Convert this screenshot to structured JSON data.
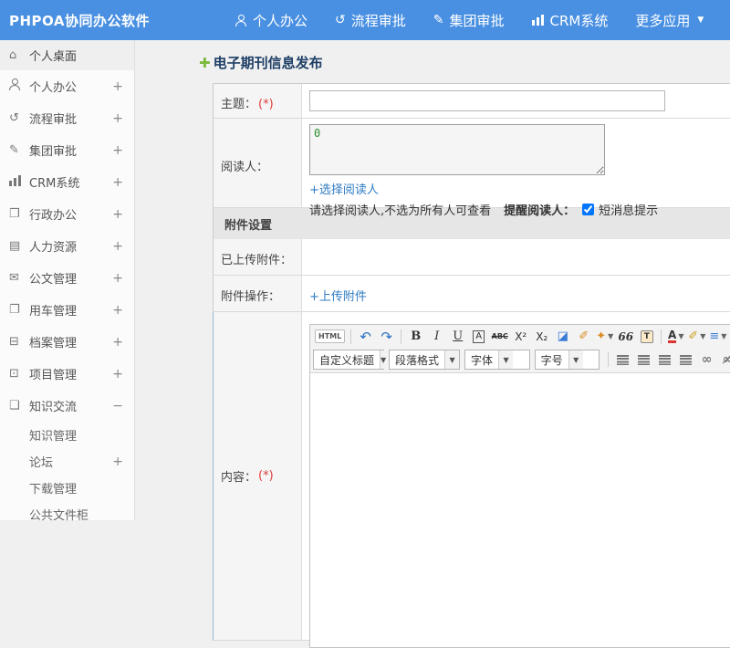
{
  "colors": {
    "header_bg": "#4a90e2",
    "accent_green": "#7cb93e",
    "link_blue": "#2f7cc4",
    "required_red": "#e03c3c",
    "title_navy": "#1f3f66"
  },
  "header": {
    "app_title": "PHPOA协同办公软件",
    "nav": [
      {
        "label": "个人办公",
        "icon": "person"
      },
      {
        "label": "流程审批",
        "icon": "workflow",
        "glyph": "↺"
      },
      {
        "label": "集团审批",
        "icon": "edit",
        "glyph": "✎"
      },
      {
        "label": "CRM系统",
        "icon": "chart-bars"
      },
      {
        "label": "更多应用",
        "icon": "more",
        "caret": "▼"
      }
    ]
  },
  "sidebar": {
    "items": [
      {
        "label": "个人桌面",
        "glyph": "⌂",
        "toggle": ""
      },
      {
        "label": "个人办公",
        "glyph": "",
        "toggle": "+"
      },
      {
        "label": "流程审批",
        "glyph": "↺",
        "toggle": "+"
      },
      {
        "label": "集团审批",
        "glyph": "✎",
        "toggle": "+"
      },
      {
        "label": "CRM系统",
        "glyph": "",
        "toggle": "+"
      },
      {
        "label": "行政办公",
        "glyph": "❒",
        "toggle": "+"
      },
      {
        "label": "人力资源",
        "glyph": "▤",
        "toggle": "+"
      },
      {
        "label": "公文管理",
        "glyph": "✉",
        "toggle": "+"
      },
      {
        "label": "用车管理",
        "glyph": "❐",
        "toggle": "+"
      },
      {
        "label": "档案管理",
        "glyph": "⊟",
        "toggle": "+"
      },
      {
        "label": "项目管理",
        "glyph": "⊡",
        "toggle": "+"
      },
      {
        "label": "知识交流",
        "glyph": "❑",
        "toggle": "−"
      }
    ],
    "subitems": [
      {
        "label": "知识管理",
        "toggle": ""
      },
      {
        "label": "论坛",
        "toggle": "+"
      },
      {
        "label": "下载管理",
        "toggle": ""
      },
      {
        "label": "公共文件柜",
        "toggle": ""
      }
    ]
  },
  "page": {
    "title": "电子期刊信息发布",
    "title_icon": "✚"
  },
  "form": {
    "subject_label": "主题：",
    "required_mark": "(*)",
    "subject_value": "",
    "readers_label": "阅读人：",
    "readers_value": "0",
    "select_readers_link": "+选择阅读人",
    "readers_hint": "请选择阅读人,不选为所有人可查看",
    "remind_label": "提醒阅读人：",
    "sms_label": "短消息提示",
    "attachment_section_title": "附件设置",
    "uploaded_label": "已上传附件：",
    "ops_label": "附件操作：",
    "upload_link": "+上传附件",
    "content_label": "内容："
  },
  "editor": {
    "row1": [
      {
        "name": "html-source",
        "glyph": "HTML"
      },
      {
        "name": "undo",
        "glyph": "↶"
      },
      {
        "name": "redo",
        "glyph": "↷"
      },
      {
        "name": "bold",
        "glyph": "B"
      },
      {
        "name": "italic",
        "glyph": "I"
      },
      {
        "name": "underline",
        "glyph": "U"
      },
      {
        "name": "font-style",
        "glyph": "A"
      },
      {
        "name": "strikethrough",
        "glyph": "ABC"
      },
      {
        "name": "superscript",
        "glyph": "X²"
      },
      {
        "name": "subscript",
        "glyph": "X₂"
      },
      {
        "name": "remove-format",
        "glyph": "◪"
      },
      {
        "name": "format-brush",
        "glyph": "✐"
      },
      {
        "name": "auto-typeset",
        "glyph": "✦"
      },
      {
        "name": "blockquote",
        "glyph": "66"
      },
      {
        "name": "paste-as-text",
        "glyph": "T"
      },
      {
        "name": "font-color",
        "glyph": "A"
      },
      {
        "name": "highlight-color",
        "glyph": "✐"
      },
      {
        "name": "ordered-list",
        "glyph": "≡"
      },
      {
        "name": "unordered-list",
        "glyph": "≡"
      }
    ],
    "selects": [
      {
        "name": "custom-heading",
        "label": "自定义标题",
        "caret": "▼"
      },
      {
        "name": "paragraph-format",
        "label": "段落格式",
        "caret": "▼"
      },
      {
        "name": "font-family",
        "label": "字体",
        "caret": "▼"
      },
      {
        "name": "font-size",
        "label": "字号",
        "caret": "▼"
      }
    ],
    "row2_icons": [
      {
        "name": "align-left"
      },
      {
        "name": "align-center"
      },
      {
        "name": "align-right"
      },
      {
        "name": "align-justify"
      },
      {
        "name": "insert-link",
        "glyph": "∞"
      },
      {
        "name": "remove-link",
        "glyph": "∞̸"
      },
      {
        "name": "insert-image"
      },
      {
        "name": "insert-media"
      }
    ]
  }
}
